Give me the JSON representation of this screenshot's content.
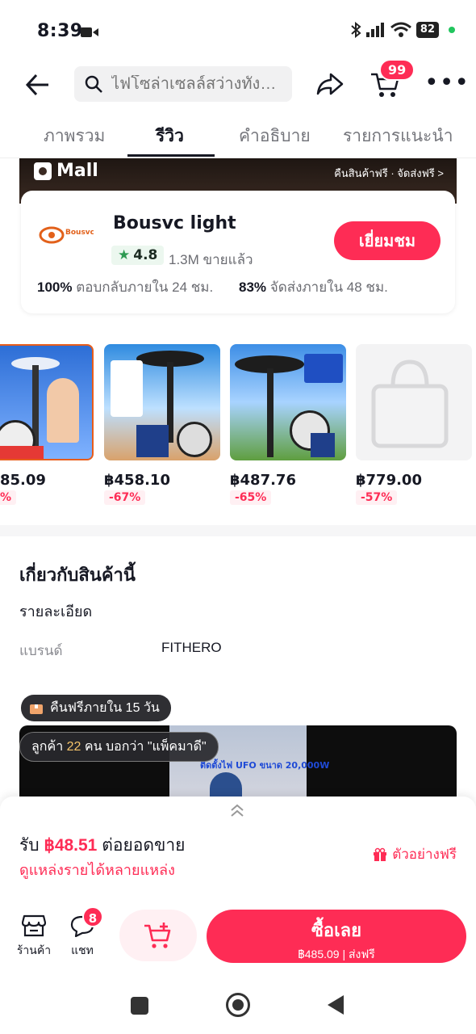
{
  "status_bar": {
    "time": "8:39",
    "battery": "82"
  },
  "header": {
    "search_placeholder": "ไฟโซล่าเซลล์สว่างทั้งคื...",
    "cart_count": "99"
  },
  "tabs": [
    {
      "label": "ภาพรวม",
      "active": false
    },
    {
      "label": "รีวิว",
      "active": true
    },
    {
      "label": "คำอธิบาย",
      "active": false
    },
    {
      "label": "รายการแนะนำ",
      "active": false
    }
  ],
  "mall": {
    "badge": "Mall",
    "info": "คืนสินค้าฟรี · จัดส่งฟรี >",
    "shop_name": "Bousvc light",
    "logo_text": "Bousvc light",
    "rating": "4.8",
    "sold": "1.3M ขายแล้ว",
    "visit_label": "เยี่ยมชม",
    "metric1_value": "100%",
    "metric1_text": "ตอบกลับภายใน 24 ชม.",
    "metric2_value": "83%",
    "metric2_text": "จัดส่งภายใน 48 ชม."
  },
  "products": [
    {
      "price": "85.09",
      "discount": "%"
    },
    {
      "price": "฿458.10",
      "discount": "-67%"
    },
    {
      "price": "฿487.76",
      "discount": "-65%"
    },
    {
      "price": "฿779.00",
      "discount": "-57%"
    }
  ],
  "about": {
    "title": "เกี่ยวกับสินค้านี้",
    "details": "รายละเอียด",
    "brand_label": "แบรนด์",
    "brand_value": "FITHERO"
  },
  "video": {
    "return_pill": "คืนฟรีภายใน 15 วัน",
    "customer_pre": "ลูกค้า ",
    "customer_num": "22",
    "customer_post": " คน บอกว่า \"แพ็คมาดี\"",
    "caption": "ติดตั้งไฟ UFO ขนาด 20,000W"
  },
  "earnings": {
    "prefix": "รับ ",
    "amount": "฿48.51",
    "suffix": " ต่อยอดขาย",
    "link": "ดูแหล่งรายได้หลายแหล่ง",
    "free_sample": "ตัวอย่างฟรี"
  },
  "actions": {
    "shop_label": "ร้านค้า",
    "chat_label": "แชท",
    "chat_badge": "8",
    "buy_label": "ซื้อเลย",
    "buy_sub": "฿485.09 | ส่งฟรี"
  },
  "colors": {
    "accent": "#fe2c55",
    "rating_star": "#2e9a52"
  }
}
